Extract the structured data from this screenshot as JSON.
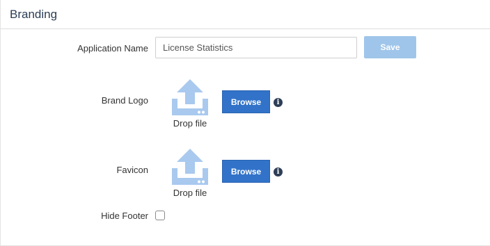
{
  "panel": {
    "title": "Branding"
  },
  "form": {
    "application_name": {
      "label": "Application Name",
      "value": "License Statistics",
      "placeholder": ""
    },
    "save_label": "Save",
    "brand_logo": {
      "label": "Brand Logo",
      "drop_text": "Drop file",
      "browse_label": "Browse",
      "info_glyph": "i"
    },
    "favicon": {
      "label": "Favicon",
      "drop_text": "Drop file",
      "browse_label": "Browse",
      "info_glyph": "i"
    },
    "hide_footer": {
      "label": "Hide Footer",
      "checked": false
    }
  },
  "icons": {
    "upload": "upload-icon",
    "info": "info-icon"
  },
  "colors": {
    "primary": "#3273c9",
    "primary_disabled": "#9fc5ea",
    "upload_icon": "#a9c9ee",
    "info_icon": "#2d3e57",
    "title": "#2b3d55"
  }
}
